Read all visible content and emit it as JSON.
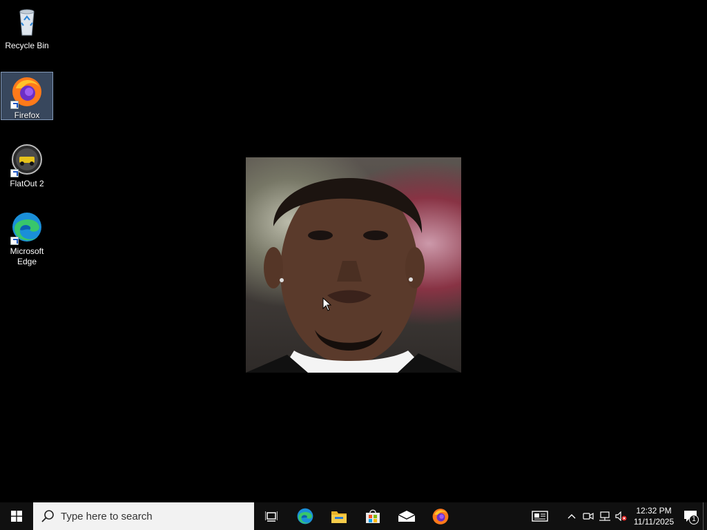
{
  "desktop": {
    "icons": [
      {
        "label": "Recycle Bin",
        "icon": "recycle-bin-icon"
      },
      {
        "label": "Firefox",
        "icon": "firefox-icon",
        "selected": true
      },
      {
        "label": "FlatOut 2",
        "icon": "flatout2-icon"
      },
      {
        "label": "Microsoft Edge",
        "icon": "edge-icon"
      }
    ]
  },
  "wallpaper": {
    "image": "portrait-photo"
  },
  "taskbar": {
    "start_icon": "windows-start-icon",
    "search_placeholder": "Type here to search",
    "apps": [
      {
        "name": "Task View",
        "icon": "task-view-icon"
      },
      {
        "name": "Microsoft Edge",
        "icon": "edge-icon"
      },
      {
        "name": "File Explorer",
        "icon": "file-explorer-icon"
      },
      {
        "name": "Microsoft Store",
        "icon": "store-icon"
      },
      {
        "name": "Mail",
        "icon": "mail-icon"
      },
      {
        "name": "Firefox",
        "icon": "firefox-icon"
      }
    ],
    "tray": {
      "time": "12:32 PM",
      "date": "11/11/2025",
      "notification_count": "1"
    }
  },
  "colors": {
    "taskbar": "#101010",
    "search_box": "#f2f2f2",
    "selection": "#6682aa"
  }
}
